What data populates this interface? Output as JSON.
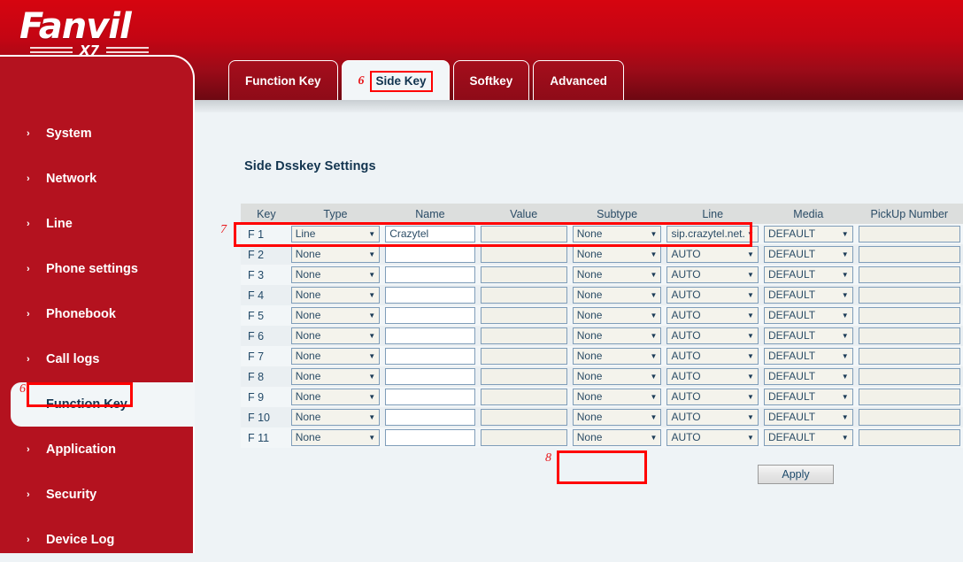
{
  "brand": {
    "name": "Fanvil",
    "model": "X7"
  },
  "sidebar": {
    "items": [
      {
        "label": "System",
        "chevron": "›",
        "active": false
      },
      {
        "label": "Network",
        "chevron": "›",
        "active": false
      },
      {
        "label": "Line",
        "chevron": "›",
        "active": false
      },
      {
        "label": "Phone settings",
        "chevron": "›",
        "active": false
      },
      {
        "label": "Phonebook",
        "chevron": "›",
        "active": false
      },
      {
        "label": "Call logs",
        "chevron": "›",
        "active": false
      },
      {
        "label": "Function Key",
        "chevron": "›",
        "active": true
      },
      {
        "label": "Application",
        "chevron": "›",
        "active": false
      },
      {
        "label": "Security",
        "chevron": "›",
        "active": false
      },
      {
        "label": "Device Log",
        "chevron": "›",
        "active": false
      }
    ],
    "annotation": "6"
  },
  "tabs": [
    {
      "label": "Function Key",
      "active": false,
      "annotation": "",
      "highlighted": false
    },
    {
      "label": "Side Key",
      "active": true,
      "annotation": "6",
      "highlighted": true
    },
    {
      "label": "Softkey",
      "active": false,
      "annotation": "",
      "highlighted": false
    },
    {
      "label": "Advanced",
      "active": false,
      "annotation": "",
      "highlighted": false
    }
  ],
  "main": {
    "page_title": "Side Dsskey Settings",
    "row_annotation": "7",
    "apply_annotation": "8",
    "apply_label": "Apply",
    "caret_glyph": "▼",
    "columns": [
      "Key",
      "Type",
      "Name",
      "Value",
      "Subtype",
      "Line",
      "Media",
      "PickUp Number"
    ],
    "rows": [
      {
        "key": "F 1",
        "type": "Line",
        "name": "Crazytel",
        "value": "",
        "subtype": "None",
        "line": "sip.crazytel.net.",
        "media": "DEFAULT",
        "pickup": ""
      },
      {
        "key": "F 2",
        "type": "None",
        "name": "",
        "value": "",
        "subtype": "None",
        "line": "AUTO",
        "media": "DEFAULT",
        "pickup": ""
      },
      {
        "key": "F 3",
        "type": "None",
        "name": "",
        "value": "",
        "subtype": "None",
        "line": "AUTO",
        "media": "DEFAULT",
        "pickup": ""
      },
      {
        "key": "F 4",
        "type": "None",
        "name": "",
        "value": "",
        "subtype": "None",
        "line": "AUTO",
        "media": "DEFAULT",
        "pickup": ""
      },
      {
        "key": "F 5",
        "type": "None",
        "name": "",
        "value": "",
        "subtype": "None",
        "line": "AUTO",
        "media": "DEFAULT",
        "pickup": ""
      },
      {
        "key": "F 6",
        "type": "None",
        "name": "",
        "value": "",
        "subtype": "None",
        "line": "AUTO",
        "media": "DEFAULT",
        "pickup": ""
      },
      {
        "key": "F 7",
        "type": "None",
        "name": "",
        "value": "",
        "subtype": "None",
        "line": "AUTO",
        "media": "DEFAULT",
        "pickup": ""
      },
      {
        "key": "F 8",
        "type": "None",
        "name": "",
        "value": "",
        "subtype": "None",
        "line": "AUTO",
        "media": "DEFAULT",
        "pickup": ""
      },
      {
        "key": "F 9",
        "type": "None",
        "name": "",
        "value": "",
        "subtype": "None",
        "line": "AUTO",
        "media": "DEFAULT",
        "pickup": ""
      },
      {
        "key": "F 10",
        "type": "None",
        "name": "",
        "value": "",
        "subtype": "None",
        "line": "AUTO",
        "media": "DEFAULT",
        "pickup": ""
      },
      {
        "key": "F 11",
        "type": "None",
        "name": "",
        "value": "",
        "subtype": "None",
        "line": "AUTO",
        "media": "DEFAULT",
        "pickup": ""
      }
    ]
  },
  "colors": {
    "brand_red": "#b4121f",
    "header_top": "#d60510",
    "header_bottom": "#6d0812",
    "annotation_red": "#ff0000",
    "content_bg": "#eef3f6",
    "text_dark": "#12344f"
  }
}
